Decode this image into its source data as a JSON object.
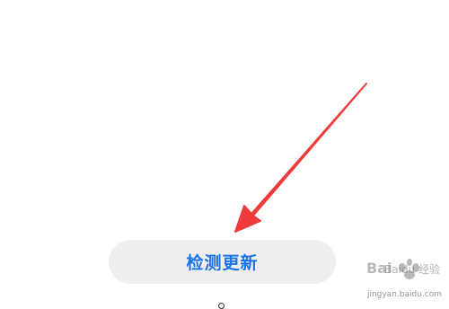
{
  "main": {
    "check_update_label": "检测更新"
  },
  "watermark": {
    "brand_text": "Baidu 经验",
    "site_text": "jingyan.baidu.com"
  },
  "colors": {
    "annotation_arrow": "#ee3b3b",
    "button_text": "#1a73e8",
    "button_background": "#efefef"
  },
  "icons": {
    "annotation": "red-arrow-icon",
    "watermark_logo": "baidu-paw-icon",
    "home_indicator": "circle-icon"
  }
}
